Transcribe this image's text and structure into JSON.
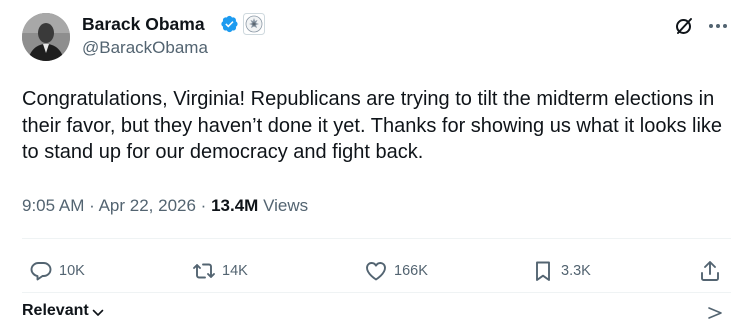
{
  "author": {
    "name": "Barack Obama",
    "handle": "@BarackObama"
  },
  "tweet": {
    "text": "Congratulations, Virginia! Republicans are trying to tilt the midterm elections in their favor, but they haven’t done it yet. Thanks for showing us what it looks like to stand up for our democracy and fight back.",
    "time": "9:05 AM",
    "dot": "·",
    "date": "Apr 22, 2026",
    "views_count": "13.4M",
    "views_label": "Views"
  },
  "actions": {
    "replies": "10K",
    "reposts": "14K",
    "likes": "166K",
    "bookmarks": "3.3K"
  },
  "footer": {
    "sort_label": "Relevant"
  },
  "icons": {
    "verified": "verified-badge-icon",
    "seal": "government-seal-icon",
    "grok": "grok-icon",
    "more": "more-icon",
    "reply": "reply-icon",
    "repost": "repost-icon",
    "like": "heart-icon",
    "bookmark": "bookmark-icon",
    "share": "share-icon"
  },
  "colors": {
    "text": "#0f1419",
    "secondary": "#536471",
    "verified": "#1d9bf0",
    "divider": "#eff3f4"
  }
}
